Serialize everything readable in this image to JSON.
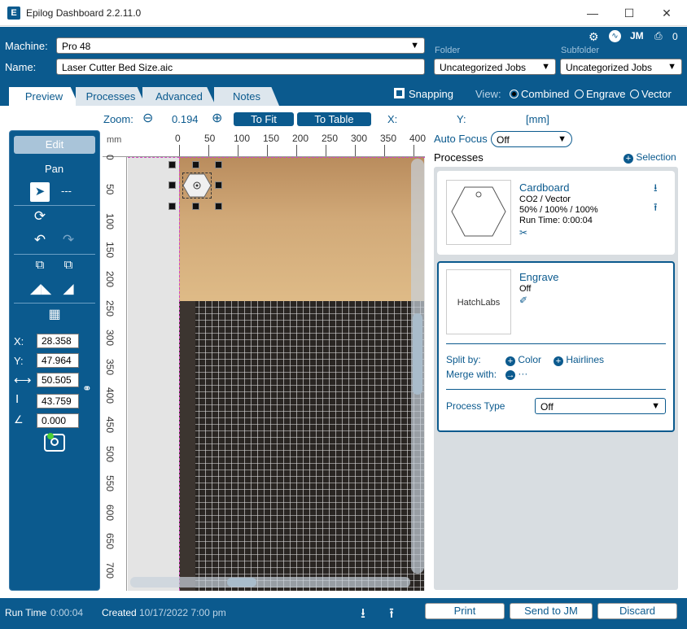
{
  "window": {
    "title": "Epilog Dashboard 2.2.11.0",
    "icon_letter": "E"
  },
  "header": {
    "machine_label": "Machine:",
    "machine_value": "Pro 48",
    "name_label": "Name:",
    "name_value": "Laser Cutter Bed Size.aic",
    "folder_label": "Folder",
    "folder_value": "Uncategorized Jobs",
    "subfolder_label": "Subfolder",
    "subfolder_value": "Uncategorized Jobs",
    "print_count": "0"
  },
  "tabs": [
    {
      "label": "Preview"
    },
    {
      "label": "Processes"
    },
    {
      "label": "Advanced"
    },
    {
      "label": "Notes"
    }
  ],
  "view": {
    "snapping_label": "Snapping",
    "view_label": "View:",
    "options": [
      "Combined",
      "Engrave",
      "Vector"
    ],
    "selected": "Combined"
  },
  "zoom": {
    "label": "Zoom:",
    "value": "0.194",
    "to_fit": "To Fit",
    "to_table": "To Table",
    "x_label": "X:",
    "y_label": "Y:",
    "units": "[mm]"
  },
  "ruler": {
    "unit": "mm",
    "top_ticks": [
      "0",
      "50",
      "100",
      "150",
      "200",
      "250",
      "300",
      "350",
      "400"
    ],
    "left_ticks": [
      "0",
      "50",
      "100",
      "150",
      "200",
      "250",
      "300",
      "350",
      "400",
      "450",
      "500",
      "550",
      "600",
      "650",
      "700"
    ]
  },
  "left_panel": {
    "edit_label": "Edit",
    "pan_label": "Pan",
    "dash_label": "---",
    "x_label": "X:",
    "x_value": "28.358",
    "y_label": "Y:",
    "y_value": "47.964",
    "w_value": "50.505",
    "h_value": "43.759",
    "angle_value": "0.000"
  },
  "right_panel": {
    "auto_focus_label": "Auto Focus",
    "auto_focus_value": "Off",
    "processes_label": "Processes",
    "selection_label": "Selection",
    "process1": {
      "name": "Cardboard",
      "type": "CO2 / Vector",
      "settings": "50% / 100% / 100%",
      "run_time": "Run Time: 0:00:04"
    },
    "process2": {
      "name": "Engrave",
      "state": "Off",
      "thumb_text": "HatchLabs",
      "split_by_label": "Split by:",
      "color_label": "Color",
      "hairlines_label": "Hairlines",
      "merge_with_label": "Merge with:",
      "merge_value": "···",
      "process_type_label": "Process Type",
      "process_type_value": "Off"
    }
  },
  "footer": {
    "run_time_label": "Run Time",
    "run_time_value": "0:00:04",
    "created_label": "Created",
    "created_value": "10/17/2022 7:00 pm",
    "print_label": "Print",
    "send_label": "Send to JM",
    "discard_label": "Discard"
  },
  "colors": {
    "brand": "#0b5a8e",
    "panel": "#d8dde1"
  }
}
